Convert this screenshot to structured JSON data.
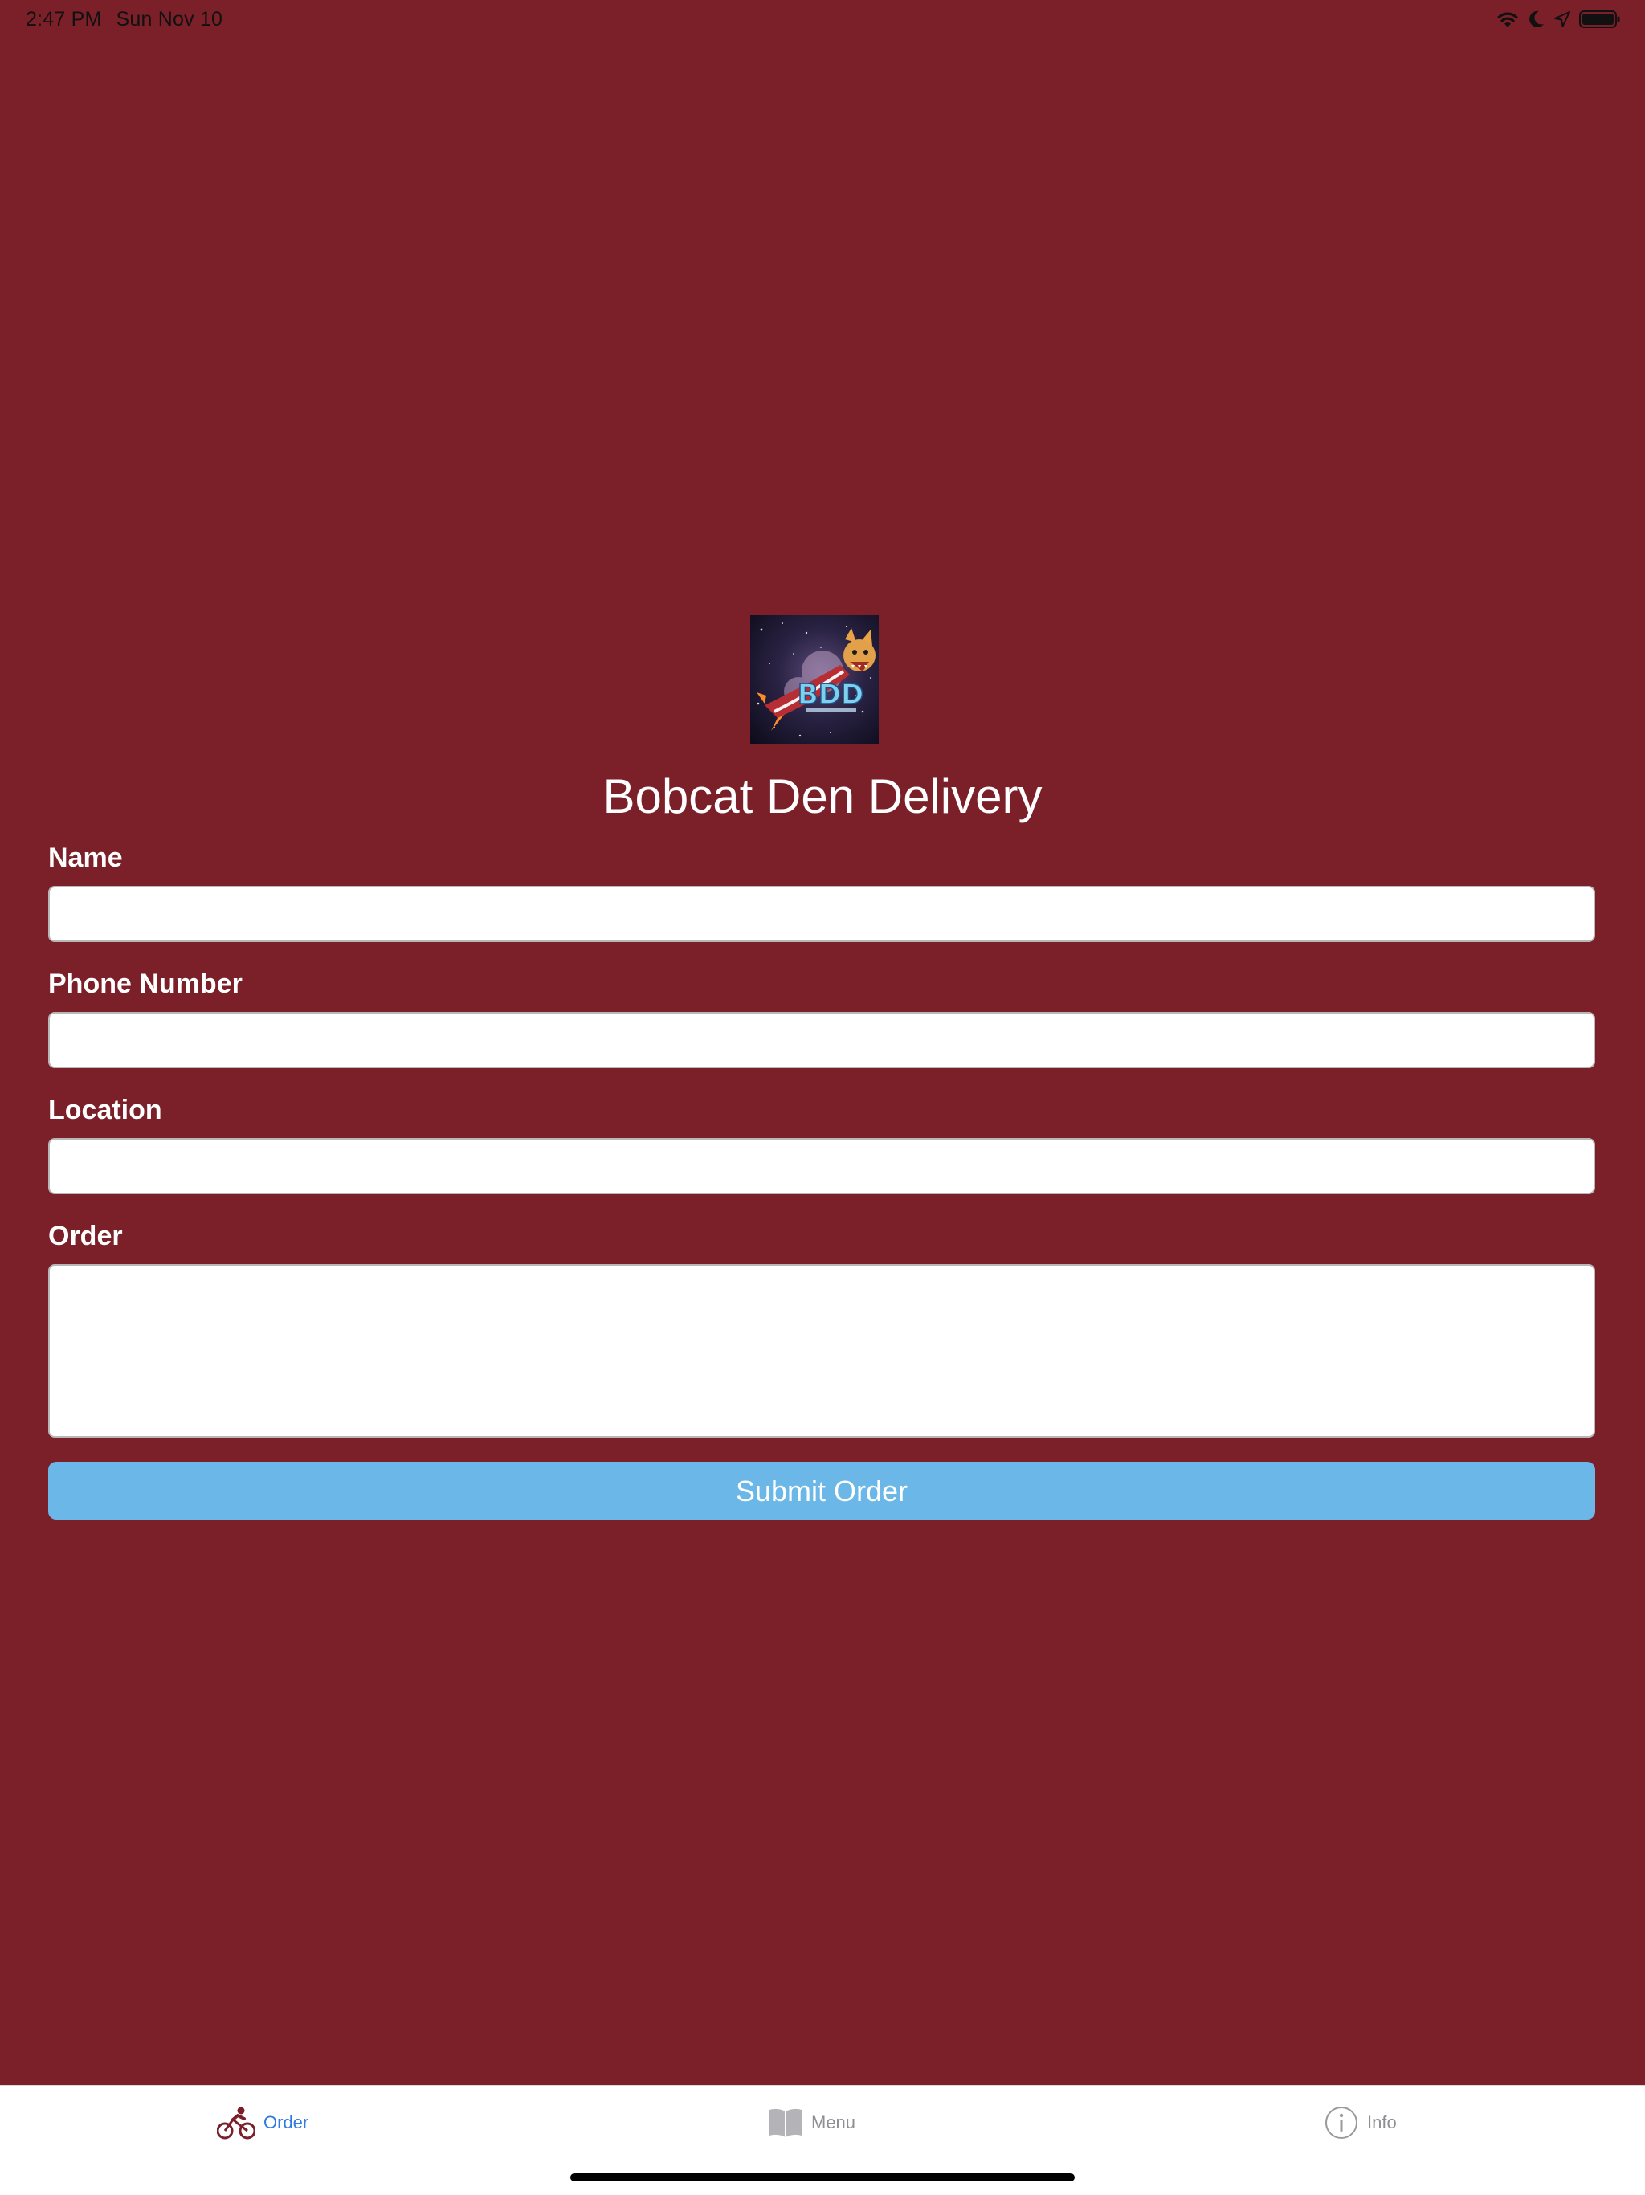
{
  "status_bar": {
    "time": "2:47 PM",
    "date": "Sun Nov 10",
    "icons": [
      "wifi-icon",
      "moon-icon",
      "location-arrow-icon",
      "battery-icon"
    ]
  },
  "app": {
    "logo_text": "BDD",
    "title": "Bobcat Den Delivery",
    "background_color": "#7b1f29"
  },
  "form": {
    "name_label": "Name",
    "name_value": "",
    "phone_label": "Phone Number",
    "phone_value": "",
    "location_label": "Location",
    "location_value": "",
    "order_label": "Order",
    "order_value": "",
    "submit_label": "Submit Order",
    "submit_color": "#6ab7e8"
  },
  "tab_bar": {
    "tabs": [
      {
        "label": "Order",
        "icon": "bicycle-icon",
        "selected": true
      },
      {
        "label": "Menu",
        "icon": "book-icon",
        "selected": false
      },
      {
        "label": "Info",
        "icon": "info-icon",
        "selected": false
      }
    ],
    "selected_color": "#2f7be0",
    "unselected_color": "#8e8e93"
  }
}
